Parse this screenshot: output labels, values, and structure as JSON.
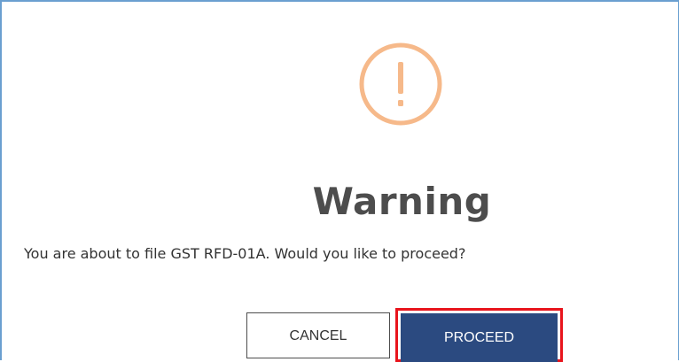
{
  "dialog": {
    "icon": "exclamation-circle-icon",
    "title": "Warning",
    "message": "You are about to file GST RFD-01A. Would you like to proceed?",
    "buttons": {
      "cancel_label": "CANCEL",
      "proceed_label": "PROCEED"
    },
    "colors": {
      "icon": "#f6b98a",
      "proceed_bg": "#2b4a80",
      "highlight": "#e8141c",
      "border": "#6a9fd0"
    }
  }
}
